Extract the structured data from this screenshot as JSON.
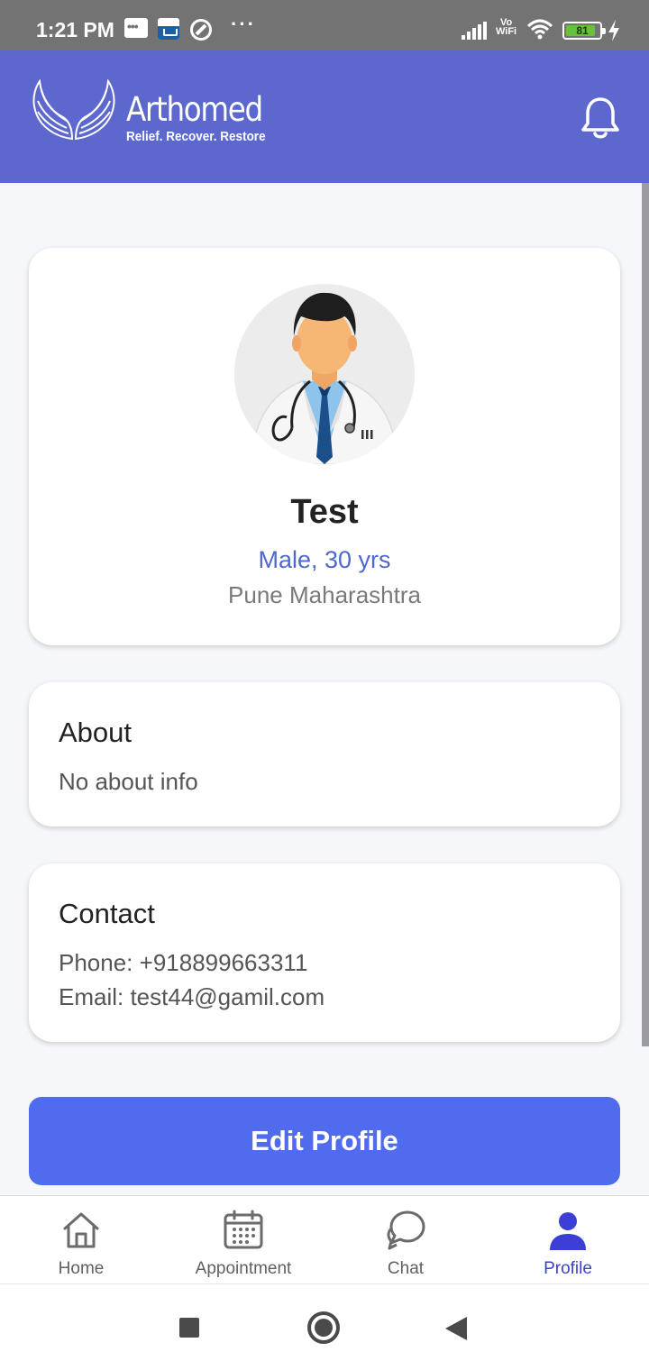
{
  "status_bar": {
    "time": "1:21 PM",
    "vowifi_top": "Vo",
    "vowifi_bottom": "WiFi",
    "battery": "81",
    "icons": [
      "message-icon",
      "amazon-shopping-icon",
      "do-not-disturb-icon",
      "more-icon",
      "signal-icon",
      "wifi-icon",
      "battery-icon",
      "charging-icon"
    ]
  },
  "header": {
    "brand": "Arthomed",
    "tagline": "Relief. Recover. Restore",
    "logo_icon": "wings-logo",
    "notification_icon": "bell-icon",
    "color": "#5c68cd"
  },
  "profile": {
    "name": "Test",
    "meta": "Male, 30 yrs",
    "location": "Pune Maharashtra",
    "avatar_icon": "doctor-avatar"
  },
  "about": {
    "title": "About",
    "text": "No about info"
  },
  "contact": {
    "title": "Contact",
    "phone": "Phone: +918899663311",
    "email": "Email: test44@gamil.com"
  },
  "actions": {
    "edit_label": "Edit Profile",
    "color": "#506bee"
  },
  "bottom_nav": {
    "items": [
      {
        "label": "Home",
        "icon": "home-icon"
      },
      {
        "label": "Appointment",
        "icon": "calendar-icon"
      },
      {
        "label": "Chat",
        "icon": "chat-icon"
      },
      {
        "label": "Profile",
        "icon": "user-icon",
        "active": true
      }
    ],
    "active_color": "#3c3fd6"
  },
  "system_nav": {
    "icons": [
      "recents-icon",
      "home-circle-icon",
      "back-icon"
    ]
  }
}
